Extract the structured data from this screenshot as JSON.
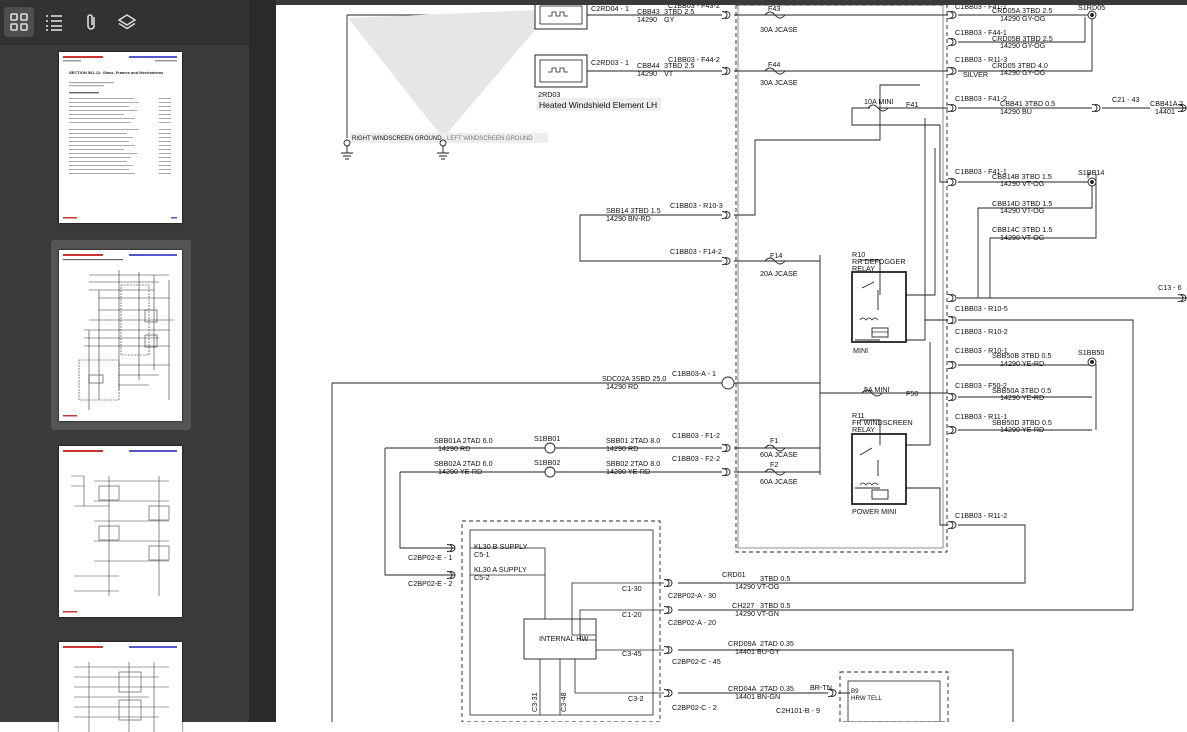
{
  "sidebar": {
    "toolbar": [
      {
        "name": "thumbnails-icon",
        "active": true
      },
      {
        "name": "outline-icon",
        "active": false
      },
      {
        "name": "attachments-icon",
        "active": false
      },
      {
        "name": "layers-icon",
        "active": false
      }
    ],
    "thumbnails": [
      {
        "page": 1,
        "selected": false,
        "heading": "SECTION 501-11: Glass, Frames and Mechanisms"
      },
      {
        "page": 2,
        "selected": true
      },
      {
        "page": 3,
        "selected": false
      },
      {
        "page": 4,
        "selected": false
      }
    ]
  },
  "diagram": {
    "labels": {
      "c2rd04": "C2RD04 - 1",
      "cbb43": "CBB43",
      "cbb43_spec": "3TBD 2.5",
      "cbb43_code": "14290",
      "cbb43_col": "GY",
      "c1bb03_f43": "C1BB03 - F43-2",
      "f43": "F43",
      "f43_type": "30A JCASE",
      "c2rd03": "C2RD03 - 1",
      "cbb44": "CBB44",
      "cbb44_spec": "3TBD 2.5",
      "cbb44_code": "14290",
      "cbb44_col": "VT",
      "c1bb03_f44": "C1BB03 - F44-2",
      "f44": "F44",
      "f44_type": "30A JCASE",
      "rd2": "2RD03",
      "rd2_name": "Heated Windshield Element LH",
      "gnd_r": "RIGHT WINDSCREEN GROUND",
      "gnd_l": "LEFT WINDSCREEN GROUND",
      "r_f41": "C1BB03 - F41-1",
      "crd05a": "CRD05A 3TBD 2.5",
      "crd05a_sub": "14290 GY-OG",
      "s1rd05": "S1RD05",
      "r_f44_1": "C1BB03 - F44-1",
      "crd05b": "CRD05B 3TBD 2.5",
      "crd05b_sub": "14290 GY-OG",
      "r_r11_3": "C1BB03 - R11-3",
      "crd05": "CRD05 3TBD 4.0",
      "crd05_sub": "14290 GY-OG",
      "silver": "SILVER",
      "mini10": "10A MINI",
      "f41": "F41",
      "r_f41_2": "C1BB03 - F41-2",
      "cbb41": "CBB41 3TBD 0.5",
      "cbb41_sub": "14290 BU",
      "c21": "C21 - 43",
      "cbb41a": "CBB41A 2",
      "cbb41a_sub": "14401",
      "r_f41_1b": "C1BB03 - F41-1",
      "cbb14b": "CBB14B 3TBD 1.5",
      "cbb14b_sub": "14290 VT-OG",
      "s1bb14": "S1BB14",
      "cbb14d": "CBB14D 3TBD 1.5",
      "cbb14d_sub": "14290 VT-OG",
      "cbb14c": "CBB14C 3TBD 1.5",
      "cbb14c_sub": "14290 VT-OG",
      "sbb14": "SBB14 3TBD 1.5",
      "sbb14_sub": "14290 BN-RD",
      "r10_3": "C1BB03 - R10-3",
      "f14_2": "C1BB03 - F14-2",
      "f14": "F14",
      "f14_type": "20A JCASE",
      "r10": "R10",
      "r10_n1": "RR DEFOGGER",
      "r10_n2": "RELAY",
      "mini": "MINI",
      "c13": "C13 - 6",
      "r10_5": "C1BB03 - R10-5",
      "r10_2": "C1BB03 - R10-2",
      "r10_1": "C1BB03 - R10-1",
      "sbb50b": "SBB50B 3TBD 0.5",
      "sbb50b_sub": "14290 YE-RD",
      "s1bb50": "S1BB50",
      "sdc02a": "SDC02A 3SBD 25.0",
      "sdc02a_sub": "14290 RD",
      "c1bb03a": "C1BB03-A - 1",
      "mini5": "5A MINI",
      "f50": "F50",
      "f50_2": "C1BB03 - F50-2",
      "sbb50a": "SBB50A 3TBD 0.5",
      "sbb50a_sub": "14290 YE-RD",
      "r11": "R11",
      "r11_n1": "FR WINDSCREEN",
      "r11_n2": "RELAY",
      "r11_1": "C1BB03 - R11-1",
      "sbb50d": "SBB50D 3TBD 0.5",
      "sbb50d_sub": "14290 YE-RD",
      "sbb01a": "SBB01A 2TAD 6.0",
      "sbb01a_sub": "14290 RD",
      "s1bb01": "S1BB01",
      "sbb01": "SBB01 2TAD 8.0",
      "sbb01_sub": "14290 RD",
      "f1_2": "C1BB03 - F1-2",
      "f1": "F1",
      "f1_type": "60A JCASE",
      "sbb02a": "SBB02A 2TAD 6.0",
      "sbb02a_sub": "14290 YE-RD",
      "s1bb02": "S1BB02",
      "sbb02": "SBB02 2TAD 8.0",
      "sbb02_sub": "14290 YE-RD",
      "f2_2": "C1BB03 - F2-2",
      "f2": "F2",
      "f2_type": "60A JCASE",
      "power_mini": "POWER MINI",
      "r11_2": "C1BB03 - R11-2",
      "kl30b": "KL30 B SUPPLY",
      "c5_1": "C5-1",
      "c2bp02e1": "C2BP02-E - 1",
      "kl30a": "KL30 A SUPPLY",
      "c5_2": "C5-2",
      "c2bp02e2": "C2BP02-E - 2",
      "internal_hw": "INTERNAL HW",
      "c1_30": "C1-30",
      "c2bp02a30": "C2BP02-A - 30",
      "crd01": "CRD01",
      "crd01_spec": "3TBD 0.5",
      "crd01_sub": "14290 VT-OG",
      "c1_20": "C1-20",
      "c2bp02a20": "C2BP02-A - 20",
      "ch227": "CH227",
      "ch227_spec": "3TBD 0.5",
      "ch227_sub": "14290 VT-GN",
      "c3_45": "C3-45",
      "c2bp02c45": "C2BP02-C - 45",
      "crd09a": "CRD09A",
      "crd09a_spec": "2TAD 0.35",
      "crd09a_sub": "14401 BU-GY",
      "c3_2": "C3-2",
      "c2bp02c2": "C2BP02-C - 2",
      "crd04a": "CRD04A",
      "crd04a_spec": "2TAD 0.35",
      "crd04a_sub": "14401 BN-GN",
      "brtn": "BR-TN",
      "c2h101b": "C2H101-B - 9",
      "b9": "B9",
      "hrw_tell": "HRW TELL",
      "c3_31": "C3-31",
      "c3_48": "C3-48"
    }
  }
}
